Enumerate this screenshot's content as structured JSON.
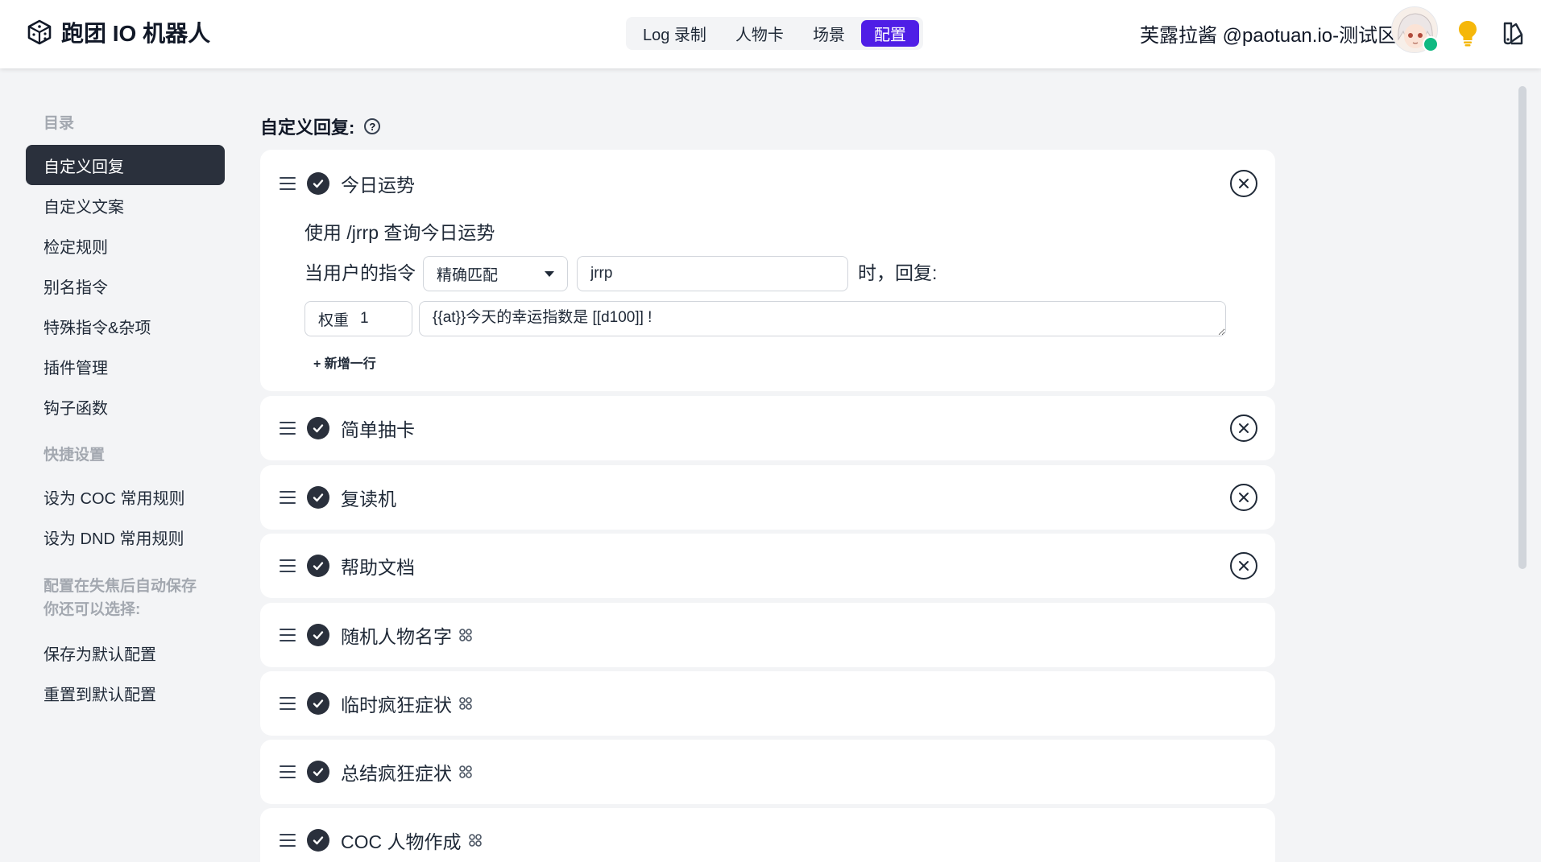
{
  "header": {
    "app_title": "跑团 IO 机器人",
    "tabs": [
      {
        "label": "Log 录制",
        "active": false
      },
      {
        "label": "人物卡",
        "active": false
      },
      {
        "label": "场景",
        "active": false
      },
      {
        "label": "配置",
        "active": true
      }
    ],
    "user": "芙露拉酱 @paotuan.io-测试区",
    "accent_color": "#4f1ee6",
    "status_color": "#10b981"
  },
  "sidebar": {
    "toc_heading": "目录",
    "items": [
      {
        "label": "自定义回复",
        "active": true
      },
      {
        "label": "自定义文案"
      },
      {
        "label": "检定规则"
      },
      {
        "label": "别名指令"
      },
      {
        "label": "特殊指令&杂项"
      },
      {
        "label": "插件管理"
      },
      {
        "label": "钩子函数"
      }
    ],
    "quick_heading": "快捷设置",
    "quick_items": [
      {
        "label": "设为 COC 常用规则"
      },
      {
        "label": "设为 DND 常用规则"
      }
    ],
    "autosave_note_1": "配置在失焦后自动保存",
    "autosave_note_2": "你还可以选择:",
    "save_items": [
      {
        "label": "保存为默认配置"
      },
      {
        "label": "重置到默认配置"
      }
    ]
  },
  "main": {
    "section_title": "自定义回复:",
    "expanded": {
      "title": "今日运势",
      "description": "使用 /jrrp 查询今日运势",
      "when_label": "当用户的指令",
      "match_mode": "精确匹配",
      "command": "jrrp",
      "reply_label": "时，回复:",
      "weight_label": "权重",
      "weight_value": "1",
      "reply_text": "{{at}}今天的幸运指数是 [[d100]] !",
      "add_row": "+ 新增一行"
    },
    "rules": [
      {
        "title": "简单抽卡",
        "plugin": false,
        "closable": true
      },
      {
        "title": "复读机",
        "plugin": false,
        "closable": true
      },
      {
        "title": "帮助文档",
        "plugin": false,
        "closable": true
      },
      {
        "title": "随机人物名字",
        "plugin": true,
        "closable": false
      },
      {
        "title": "临时疯狂症状",
        "plugin": true,
        "closable": false
      },
      {
        "title": "总结疯狂症状",
        "plugin": true,
        "closable": false
      },
      {
        "title": "COC 人物作成",
        "plugin": true,
        "closable": false
      }
    ]
  }
}
